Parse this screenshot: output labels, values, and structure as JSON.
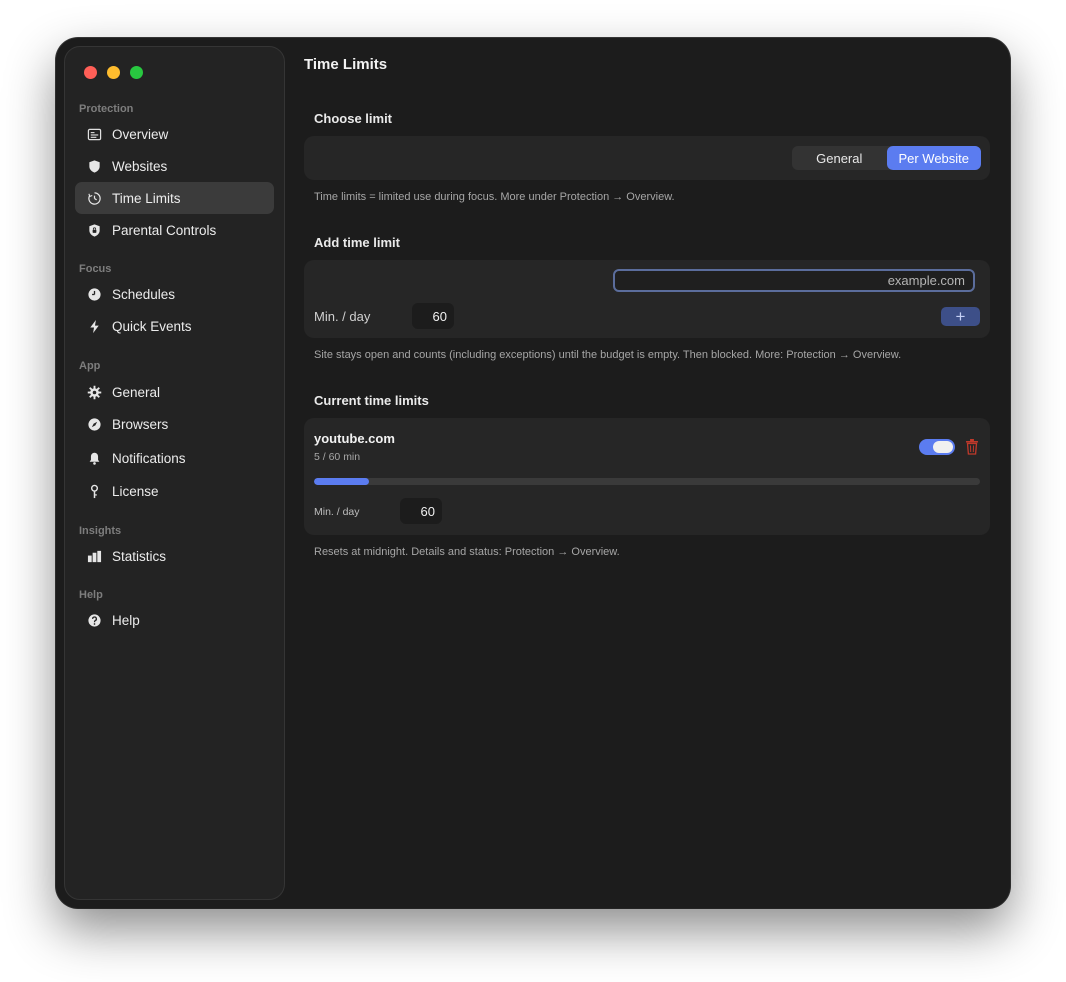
{
  "window": {
    "title": "Time Limits"
  },
  "sidebar": {
    "sections": [
      {
        "label": "Protection",
        "items": [
          {
            "label": "Overview",
            "icon": "overview-icon",
            "active": false
          },
          {
            "label": "Websites",
            "icon": "shield-icon",
            "active": false
          },
          {
            "label": "Time Limits",
            "icon": "timer-icon",
            "active": true
          },
          {
            "label": "Parental Controls",
            "icon": "shield-lock-icon",
            "active": false
          }
        ]
      },
      {
        "label": "Focus",
        "items": [
          {
            "label": "Schedules",
            "icon": "clock-icon",
            "active": false
          },
          {
            "label": "Quick Events",
            "icon": "bolt-icon",
            "active": false
          }
        ]
      },
      {
        "label": "App",
        "items": [
          {
            "label": "General",
            "icon": "gear-icon",
            "active": false
          },
          {
            "label": "Browsers",
            "icon": "compass-icon",
            "active": false
          },
          {
            "label": "Notifications",
            "icon": "bell-icon",
            "active": false
          },
          {
            "label": "License",
            "icon": "key-icon",
            "active": false
          }
        ]
      },
      {
        "label": "Insights",
        "items": [
          {
            "label": "Statistics",
            "icon": "bar-chart-icon",
            "active": false
          }
        ]
      },
      {
        "label": "Help",
        "items": [
          {
            "label": "Help",
            "icon": "help-icon",
            "active": false
          }
        ]
      }
    ]
  },
  "main": {
    "title": "Time Limits",
    "choose_limit": {
      "heading": "Choose limit",
      "options": [
        "General",
        "Per Website"
      ],
      "selected": "Per Website",
      "caption": "Time limits = limited use during focus. More under Protection → Overview."
    },
    "add_limit": {
      "heading": "Add time limit",
      "domain_placeholder": "example.com",
      "domain_value": "",
      "min_label": "Min. / day",
      "min_value": "60",
      "add_label": "+",
      "caption": "Site stays open and counts (including exceptions) until the budget is empty. Then blocked. More: Protection → Overview."
    },
    "current": {
      "heading": "Current time limits",
      "items": [
        {
          "site": "youtube.com",
          "usage": "5 / 60 min",
          "used_fraction": 0.0833,
          "enabled": true,
          "min_label": "Min. / day",
          "min_value": "60"
        }
      ],
      "caption": "Resets at midnight. Details and status: Protection → Overview."
    }
  },
  "colors": {
    "accent": "#5b7cf0",
    "delete": "#c0392b"
  }
}
